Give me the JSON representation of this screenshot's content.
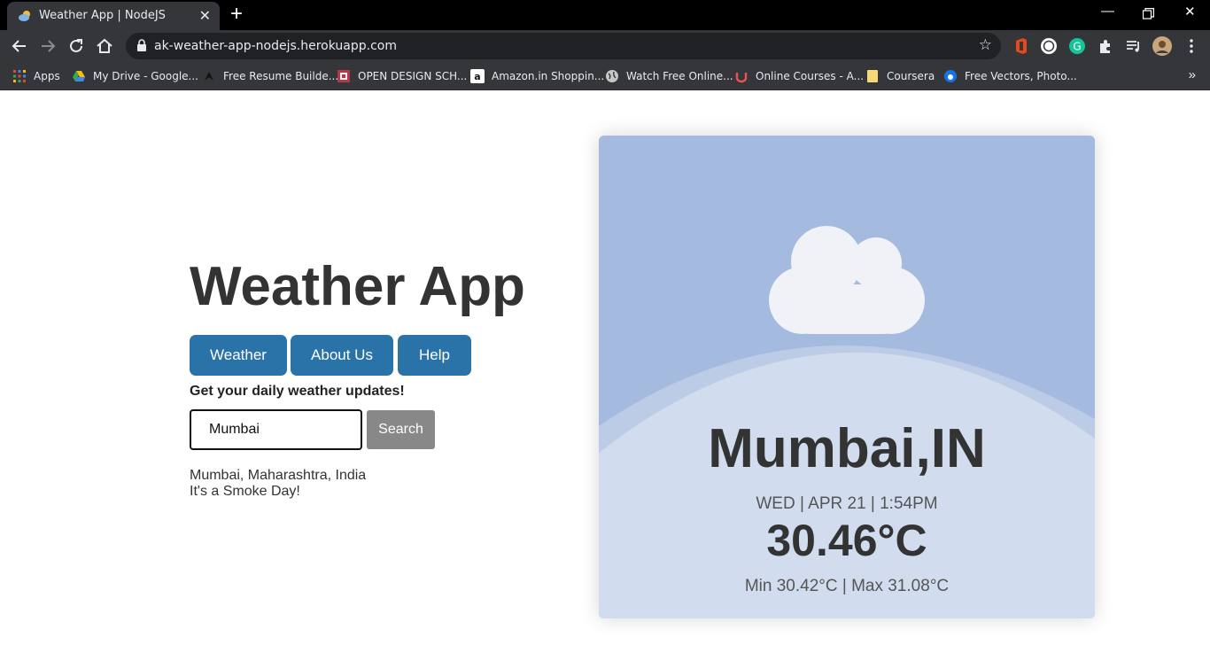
{
  "browser": {
    "tab_title": "Weather App | NodeJS",
    "url": "ak-weather-app-nodejs.herokuapp.com",
    "bookmarks": [
      {
        "label": "Apps",
        "icon": "apps-grid-icon"
      },
      {
        "label": "My Drive - Google...",
        "icon": "google-drive-icon"
      },
      {
        "label": "Free Resume Builde...",
        "icon": "resume-builder-icon"
      },
      {
        "label": "OPEN DESIGN SCH...",
        "icon": "open-design-icon"
      },
      {
        "label": "Amazon.in Shoppin...",
        "icon": "amazon-icon"
      },
      {
        "label": "Watch Free Online...",
        "icon": "globe-icon"
      },
      {
        "label": "Online Courses - A...",
        "icon": "udemy-icon"
      },
      {
        "label": "Coursera",
        "icon": "folder-icon"
      },
      {
        "label": "Free Vectors, Photo...",
        "icon": "freepik-icon"
      }
    ]
  },
  "page": {
    "title": "Weather App",
    "nav": {
      "weather": "Weather",
      "about": "About Us",
      "help": "Help"
    },
    "tagline": "Get your daily weather updates!",
    "search": {
      "value": "Mumbai",
      "button": "Search"
    },
    "result": {
      "location": "Mumbai, Maharashtra, India",
      "message": "It's a Smoke Day!"
    }
  },
  "card": {
    "city": "Mumbai,IN",
    "datetime": "WED | APR 21 | 1:54PM",
    "temp": "30.46°C",
    "minmax": "Min 30.42°C | Max 31.08°C",
    "icon": "cloud-icon"
  },
  "colors": {
    "button": "#2a73a8",
    "search_button": "#888888",
    "card_bg": "#a4bade",
    "card_hill": "#d1ddee"
  }
}
